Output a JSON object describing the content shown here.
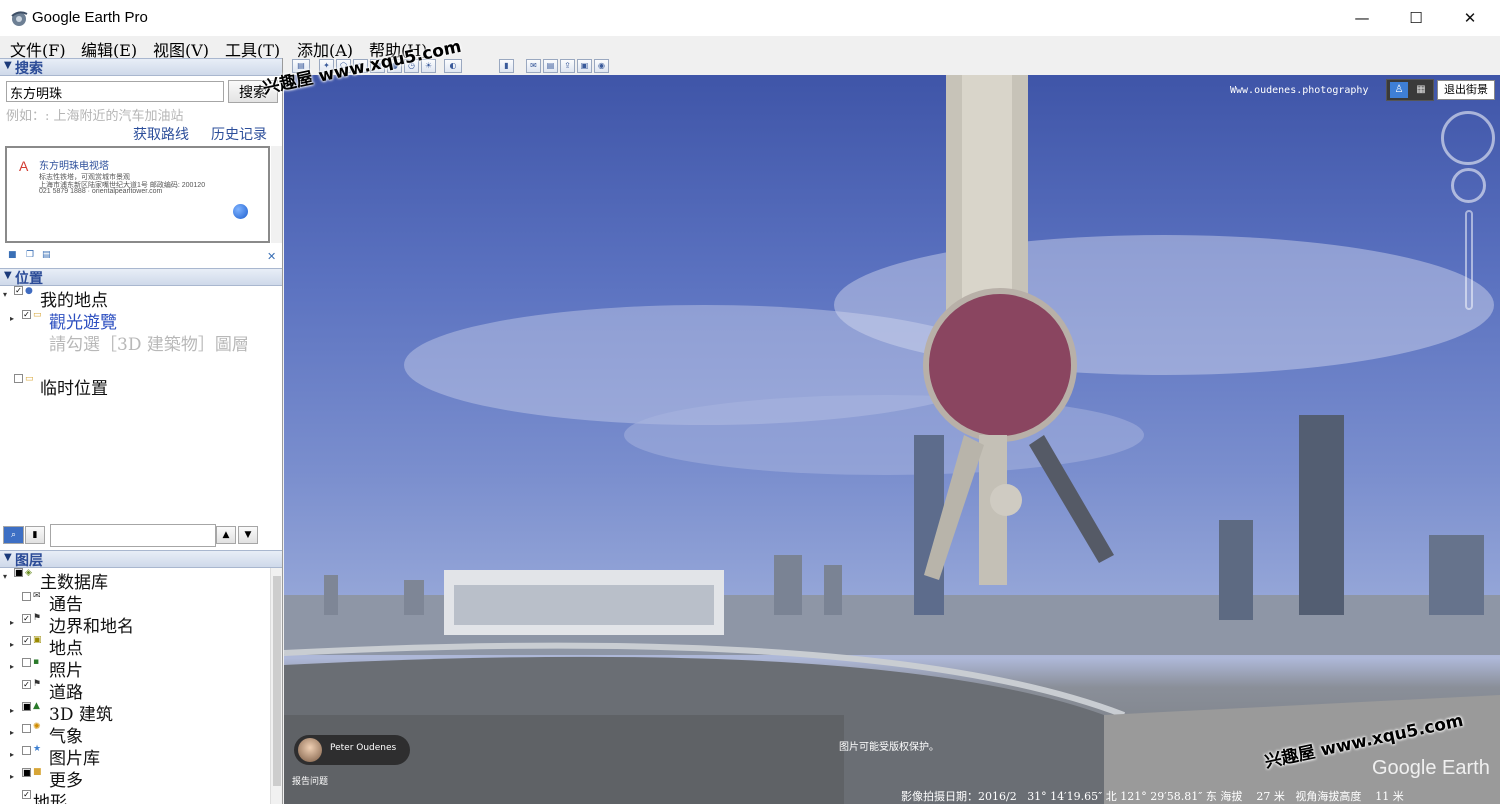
{
  "window": {
    "title": "Google Earth Pro",
    "minimize": "—",
    "maximize": "☐",
    "close": "✕"
  },
  "menu": [
    "文件(F)",
    "编辑(E)",
    "视图(V)",
    "工具(T)",
    "添加(A)",
    "帮助(H)"
  ],
  "search_panel": {
    "header": "搜索",
    "query": "东方明珠",
    "search_button": "搜索",
    "hint": "例如：: 上海附近的汽车加油站",
    "get_directions": "获取路线",
    "history": "历史记录",
    "result": {
      "marker": "A",
      "title": "东方明珠电视塔",
      "line1": "标志性铁塔，可观赏城市景观",
      "line2": "上海市浦东新区陆家嘴世纪大道1号 邮政编码: 200120",
      "line3": "021 5879 1888 · orientalpearltower.com"
    }
  },
  "places_panel": {
    "header": "位置",
    "items": [
      {
        "label": "我的地点",
        "checked": true
      },
      {
        "label": "觀光遊覽",
        "checked": true
      },
      {
        "label": "請勾選［3D 建築物］圖層",
        "checked": false
      },
      {
        "label": "临时位置",
        "checked": false
      }
    ]
  },
  "layers_panel": {
    "header": "图层",
    "up": "▲",
    "down": "▼",
    "items": [
      {
        "label": "主数据库",
        "checked": true
      },
      {
        "label": "通告",
        "checked": false
      },
      {
        "label": "边界和地名",
        "checked": true
      },
      {
        "label": "地点",
        "checked": true
      },
      {
        "label": "照片",
        "checked": false
      },
      {
        "label": "道路",
        "checked": true
      },
      {
        "label": "3D 建筑",
        "checked": true
      },
      {
        "label": "气象",
        "checked": false
      },
      {
        "label": "图片库",
        "checked": false
      },
      {
        "label": "更多",
        "checked": true
      },
      {
        "label": "地形",
        "checked": true
      }
    ]
  },
  "view": {
    "photo_credit": "Www.oudenes.photography",
    "exit_streetview": "退出街景",
    "user_name": "Peter Oudenes",
    "report": "报告问题",
    "copyright_note": "图片可能受版权保护。",
    "status": "影像拍摄日期：2016/2   31° 14′19.65″ 北 121° 29′58.81″ 东 海拔    27 米   视角海拔高度    11 米",
    "brand": "Google Earth"
  },
  "watermark": "兴趣屋 www.xqu5.com",
  "colors": {
    "link_blue": "#2d4f9b",
    "panel_header": "#2b4b97",
    "sky_top": "#3f55a8",
    "sky_bottom": "#aeb8d8"
  }
}
